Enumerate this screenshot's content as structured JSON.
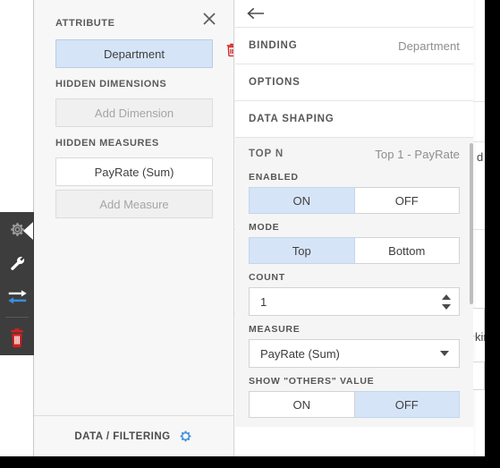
{
  "background": {
    "occluded_text_right": "d",
    "occluded_text_lower": "kin"
  },
  "icon_rail": {
    "items": [
      {
        "name": "gear-icon",
        "label": "Settings",
        "active": true
      },
      {
        "name": "wrench-icon",
        "label": "Tools",
        "active": false
      },
      {
        "name": "swap-arrows-icon",
        "label": "Swap",
        "active": false
      },
      {
        "name": "trash-icon",
        "label": "Delete",
        "active": false
      }
    ]
  },
  "left_panel": {
    "close_label": "Close",
    "sections": [
      {
        "label": "ATTRIBUTE",
        "fields": [
          {
            "text": "Department",
            "state": "selected"
          }
        ]
      },
      {
        "label": "HIDDEN DIMENSIONS",
        "fields": [
          {
            "text": "Add Dimension",
            "state": "empty"
          }
        ]
      },
      {
        "label": "HIDDEN MEASURES",
        "fields": [
          {
            "text": "PayRate (Sum)",
            "state": "filled"
          },
          {
            "text": "Add Measure",
            "state": "empty"
          }
        ]
      }
    ],
    "attribute_label": "ATTRIBUTE",
    "attribute_value": "Department",
    "hidden_dimensions_label": "HIDDEN DIMENSIONS",
    "add_dimension_label": "Add Dimension",
    "hidden_measures_label": "HIDDEN MEASURES",
    "measure_value": "PayRate (Sum)",
    "add_measure_label": "Add Measure",
    "footer_label": "DATA / FILTERING",
    "delete_tooltip": "Delete attribute"
  },
  "right_panel": {
    "back_label": "Back",
    "accordion": [
      {
        "title": "BINDING",
        "value": "Department"
      },
      {
        "title": "OPTIONS",
        "value": ""
      },
      {
        "title": "DATA SHAPING",
        "value": ""
      }
    ],
    "binding_title": "BINDING",
    "binding_value": "Department",
    "options_title": "OPTIONS",
    "data_shaping_title": "DATA SHAPING",
    "topn": {
      "title": "TOP N",
      "summary": "Top 1 - PayRate",
      "enabled_label": "ENABLED",
      "enabled_on": "ON",
      "enabled_off": "OFF",
      "enabled_selected": "ON",
      "mode_label": "MODE",
      "mode_top": "Top",
      "mode_bottom": "Bottom",
      "mode_selected": "Top",
      "count_label": "COUNT",
      "count_value": "1",
      "measure_label": "MEASURE",
      "measure_value": "PayRate (Sum)",
      "others_label": "SHOW \"OTHERS\" VALUE",
      "others_on": "ON",
      "others_off": "OFF",
      "others_selected": "OFF"
    }
  },
  "colors": {
    "accent_selected": "#d6e4f7",
    "accent_blue": "#3d8ddd",
    "danger_red": "#d32020",
    "rail_bg": "#3d3d3d",
    "panel_bg": "#f7f7f7"
  }
}
